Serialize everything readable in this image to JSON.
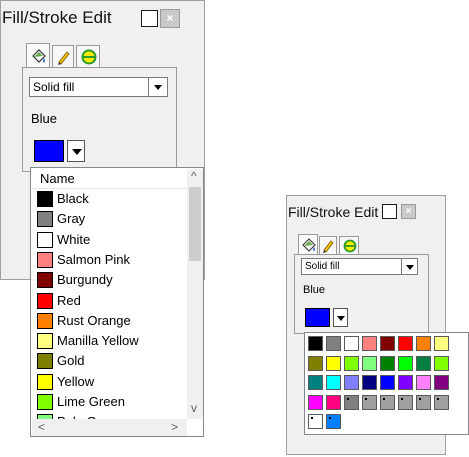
{
  "left": {
    "title": "Fill/Stroke Edit",
    "close_glyph": "×",
    "fill_type": "Solid fill",
    "color_label": "Blue",
    "list_header": "Name",
    "scroll_left": "<",
    "scroll_right": ">",
    "scroll_up": "^",
    "scroll_down": "v",
    "colors": [
      {
        "name": "Black",
        "hex": "#000000"
      },
      {
        "name": "Gray",
        "hex": "#808080"
      },
      {
        "name": "White",
        "hex": "#ffffff"
      },
      {
        "name": "Salmon Pink",
        "hex": "#ff8080"
      },
      {
        "name": "Burgundy",
        "hex": "#800000"
      },
      {
        "name": "Red",
        "hex": "#ff0000"
      },
      {
        "name": "Rust Orange",
        "hex": "#ff8000"
      },
      {
        "name": "Manilla Yellow",
        "hex": "#ffff80"
      },
      {
        "name": "Gold",
        "hex": "#808000"
      },
      {
        "name": "Yellow",
        "hex": "#ffff00"
      },
      {
        "name": "Lime Green",
        "hex": "#80ff00"
      },
      {
        "name": "Pale Green",
        "hex": "#80ff80"
      }
    ]
  },
  "right": {
    "title": "Fill/Stroke Edit",
    "close_glyph": "×",
    "fill_type": "Solid fill",
    "color_label": "Blue",
    "grid_colors": [
      [
        "#000000",
        "#808080",
        "#ffffff",
        "#ff8080",
        "#800000",
        "#ff0000",
        "#ff8000",
        "#ffff80"
      ],
      [
        "#808000",
        "#ffff00",
        "#80ff00",
        "#80ff80",
        "#008000",
        "#00ff00",
        "#008040",
        "#80ff00"
      ],
      [
        "#008080",
        "#00ffff",
        "#8080ff",
        "#000080",
        "#0000ff",
        "#8000ff",
        "#ff80ff",
        "#800080"
      ],
      [
        "#ff00ff",
        "#ff0080",
        "#808080",
        "#a0a0a0",
        "#a0a0a0",
        "#a0a0a0",
        "#a0a0a0",
        "#a0a0a0"
      ],
      [
        "#ffffff",
        "#0080ff"
      ]
    ],
    "selected_color": "#0000ff"
  }
}
